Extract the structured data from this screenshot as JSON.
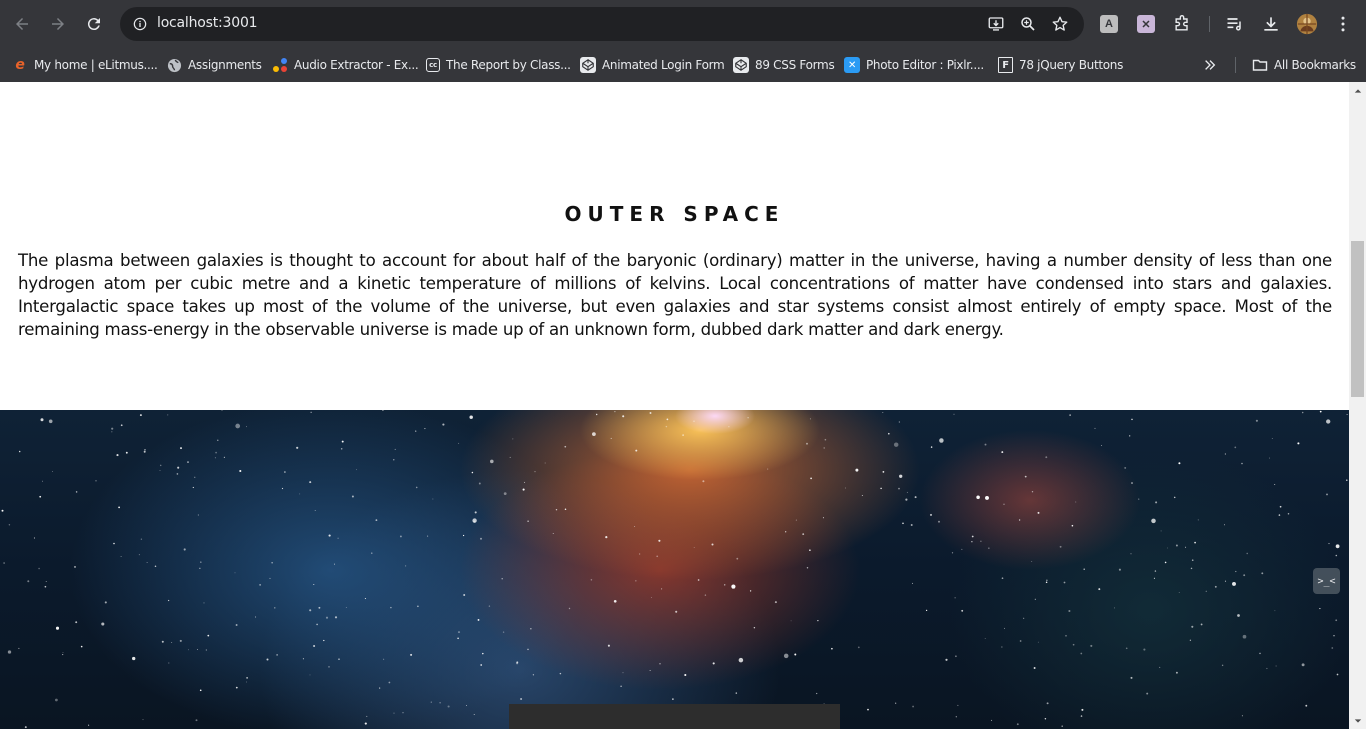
{
  "browser": {
    "url": "localhost:3001",
    "bookmarks": [
      {
        "label": "My home | eLitmus....",
        "icon": "elitmus-icon",
        "color": "#e8632a"
      },
      {
        "label": "Assignments",
        "icon": "globe-icon",
        "color": "#bdc1c6"
      },
      {
        "label": "Audio Extractor - Ex...",
        "icon": "audio-extractor-icon",
        "color": "#fbbc04"
      },
      {
        "label": "The Report by Class...",
        "icon": "cc-icon",
        "color": "#e8eaed"
      },
      {
        "label": "Animated Login Form",
        "icon": "codepen-icon",
        "color": "#e8eaed"
      },
      {
        "label": "89 CSS Forms",
        "icon": "codepen-icon",
        "color": "#e8eaed"
      },
      {
        "label": "Photo Editor : Pixlr....",
        "icon": "pixlr-icon",
        "color": "#2b9bf4"
      },
      {
        "label": "78 jQuery Buttons",
        "icon": "f-icon",
        "color": "#e8eaed"
      }
    ],
    "all_bookmarks_label": "All Bookmarks"
  },
  "page": {
    "title": "OUTER SPACE",
    "paragraph": "The plasma between galaxies is thought to account for about half of the baryonic (ordinary) matter in the universe, having a number density of less than one hydrogen atom per cubic metre and a kinetic temperature of millions of kelvins. Local concentrations of matter have condensed into stars and galaxies. Intergalactic space takes up most of the volume of the universe, but even galaxies and star systems consist almost entirely of empty space. Most of the remaining mass-energy in the observable universe is made up of an unknown form, dubbed dark matter and dark energy.",
    "hero_image": "galaxy-nebula-image",
    "widget_glyph": ">_<"
  }
}
